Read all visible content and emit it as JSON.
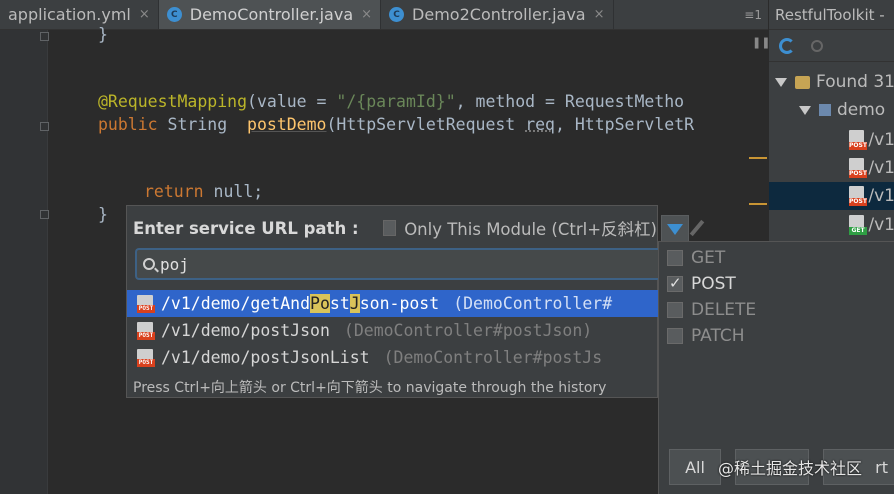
{
  "tabs": [
    {
      "label": "application.yml",
      "active": false
    },
    {
      "label": "DemoController.java",
      "active": true
    },
    {
      "label": "Demo2Controller.java",
      "active": false
    }
  ],
  "tab_close": "×",
  "tab_menu": "≡1",
  "editor": {
    "line_brace_close": "}",
    "ann": "@RequestMapping",
    "ann_open": "(value = ",
    "ann_str": "\"/{paramId}\"",
    "ann_rest": ", method = RequestMetho",
    "kw_public": "public",
    "decl_type": " String  ",
    "fn_name": "postDemo",
    "decl_args_a": "(HttpServletRequest ",
    "param_req": "req",
    "decl_args_b": ", HttpServletR",
    "kw_return": "return",
    "return_rest": " null;",
    "brace_close": "}"
  },
  "toolkit": {
    "title": "RestfulToolkit - ",
    "found": "Found 31",
    "module": "demo",
    "items": [
      {
        "label": "/v1",
        "method": "POST"
      },
      {
        "label": "/v1",
        "method": "POST"
      },
      {
        "label": "/v1",
        "method": "POST",
        "selected": true
      },
      {
        "label": "/v1",
        "method": "GET"
      }
    ]
  },
  "popup": {
    "label": "Enter service URL path :",
    "module_checkbox": "Only This Module (Ctrl+反斜杠)",
    "search_value": "poj",
    "results": [
      {
        "pre": "/v1/demo/getAnd",
        "hl1": "Po",
        "mid": "st",
        "hl2": "J",
        "post": "son-post",
        "hint": "(DemoController#",
        "method": "POST",
        "selected": true
      },
      {
        "text": "/v1/demo/postJson",
        "hint": "(DemoController#postJson)",
        "method": "POST"
      },
      {
        "text": "/v1/demo/postJsonList",
        "hint": "(DemoController#postJs",
        "method": "POST"
      }
    ],
    "footer": "Press Ctrl+向上箭头 or Ctrl+向下箭头 to navigate through the history"
  },
  "methods": [
    {
      "label": "GET",
      "checked": false
    },
    {
      "label": "POST",
      "checked": true
    },
    {
      "label": "DELETE",
      "checked": false
    },
    {
      "label": "PATCH",
      "checked": false
    }
  ],
  "panel_buttons": {
    "all": "All",
    "invert": "rt"
  },
  "watermark": "@稀土掘金技术社区"
}
